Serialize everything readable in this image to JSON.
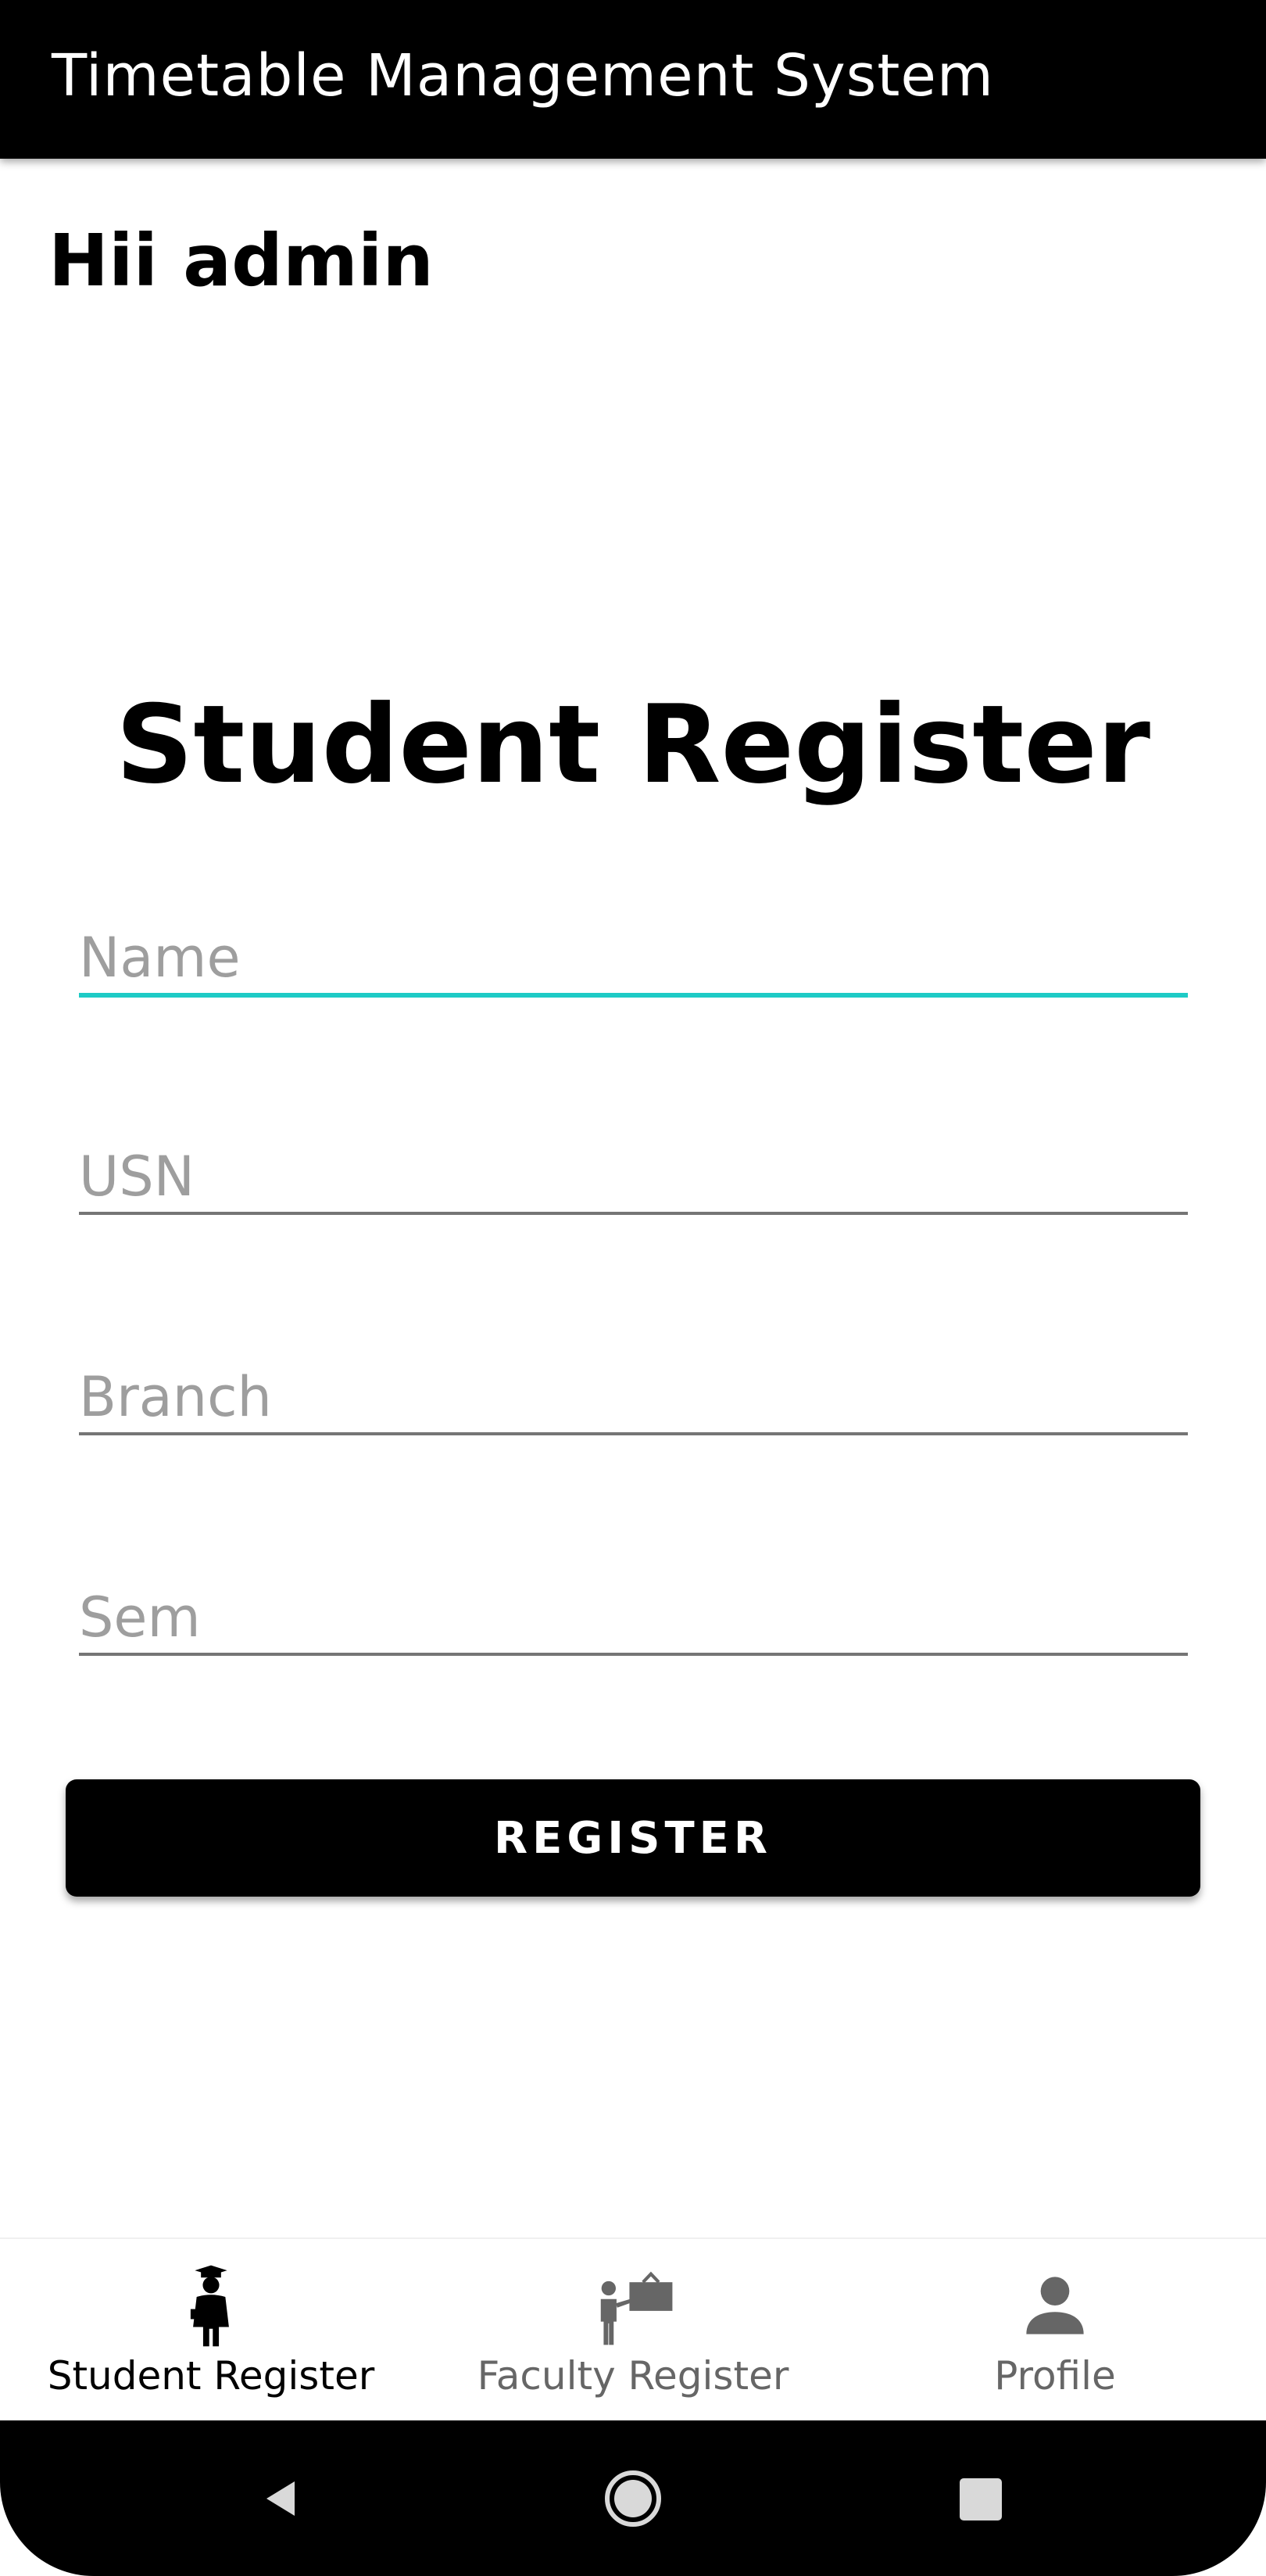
{
  "app_bar": {
    "title": "Timetable Management System"
  },
  "greeting": "Hii admin",
  "form": {
    "title": "Student Register",
    "fields": [
      {
        "placeholder": "Name",
        "value": ""
      },
      {
        "placeholder": "USN",
        "value": ""
      },
      {
        "placeholder": "Branch",
        "value": ""
      },
      {
        "placeholder": "Sem",
        "value": ""
      }
    ],
    "register_label": "REGISTER"
  },
  "bottom_nav": {
    "items": [
      {
        "label": "Student Register",
        "icon": "student-icon",
        "active": true
      },
      {
        "label": "Faculty Register",
        "icon": "teacher-icon",
        "active": false
      },
      {
        "label": "Profile",
        "icon": "person-icon",
        "active": false
      }
    ]
  },
  "system_nav": {
    "buttons": [
      "back-icon",
      "home-icon",
      "recents-icon"
    ]
  },
  "colors": {
    "primary": "#000000",
    "focus_accent": "#1ecbc6",
    "hint": "#9e9e9e",
    "inactive_nav": "#666666"
  }
}
